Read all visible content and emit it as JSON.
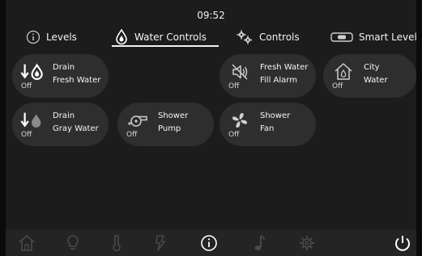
{
  "status": {
    "time": "09:52"
  },
  "tabs": [
    {
      "label": "Levels",
      "icon": "info-circle-icon"
    },
    {
      "label": "Water Controls",
      "icon": "water-drop-icon",
      "active": true
    },
    {
      "label": "Controls",
      "icon": "gears-icon"
    },
    {
      "label": "Smart Level",
      "icon": "level-bubble-icon"
    }
  ],
  "tiles": [
    {
      "line1": "Drain",
      "line2": "Fresh Water",
      "state": "Off",
      "icon": "drain-fresh-water-icon"
    },
    {
      "line1": "Fresh Water",
      "line2": "Fill Alarm",
      "state": "Off",
      "icon": "alarm-muted-icon"
    },
    {
      "line1": "City",
      "line2": "Water",
      "state": "Off",
      "icon": "house-icon"
    },
    {
      "line1": "Drain",
      "line2": "Gray Water",
      "state": "Off",
      "icon": "drain-gray-water-icon"
    },
    {
      "line1": "Shower",
      "line2": "Pump",
      "state": "Off",
      "icon": "pump-icon"
    },
    {
      "line1": "Shower",
      "line2": "Fan",
      "state": "Off",
      "icon": "fan-icon"
    }
  ],
  "bottom_nav": [
    {
      "icon": "home-icon",
      "active": false
    },
    {
      "icon": "lightbulb-icon",
      "active": false
    },
    {
      "icon": "thermometer-icon",
      "active": false
    },
    {
      "icon": "power-bolt-icon",
      "active": false
    },
    {
      "icon": "info-icon",
      "active": true
    },
    {
      "icon": "music-note-icon",
      "active": false
    },
    {
      "icon": "settings-gear-icon",
      "active": false
    },
    {
      "icon": "power-icon",
      "active": true
    }
  ],
  "colors": {
    "background": "#1c1c1c",
    "tile": "#2e2e2e",
    "active": "#ffffff",
    "inactive": "#4a4a4a",
    "accent_gray_drop": "#8a8a8a"
  }
}
